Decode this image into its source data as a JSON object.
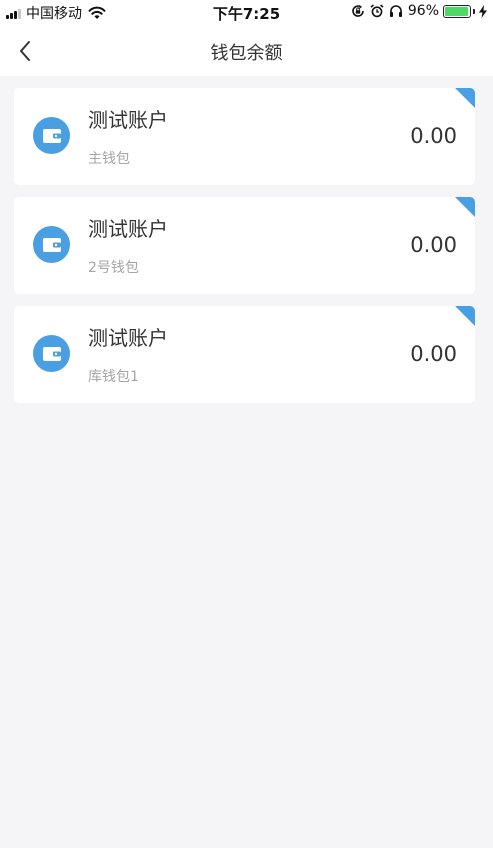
{
  "status_bar": {
    "carrier": "中国移动",
    "time": "下午7:25",
    "battery_percent": "96%",
    "battery_level": 0.96,
    "icons": [
      "signal-icon",
      "wifi-icon",
      "rotation-lock-icon",
      "alarm-icon",
      "headphones-icon",
      "battery-icon",
      "charging-icon"
    ]
  },
  "nav": {
    "title": "钱包余额",
    "back_icon": "chevron-left-icon"
  },
  "theme": {
    "accent": "#4a9fe2",
    "background": "#f5f5f7",
    "card": "#ffffff"
  },
  "wallets": [
    {
      "title": "测试账户",
      "subtitle": "主钱包",
      "amount": "0.00",
      "icon": "wallet-icon"
    },
    {
      "title": "测试账户",
      "subtitle": "2号钱包",
      "amount": "0.00",
      "icon": "wallet-icon"
    },
    {
      "title": "测试账户",
      "subtitle": "库钱包1",
      "amount": "0.00",
      "icon": "wallet-icon"
    }
  ]
}
